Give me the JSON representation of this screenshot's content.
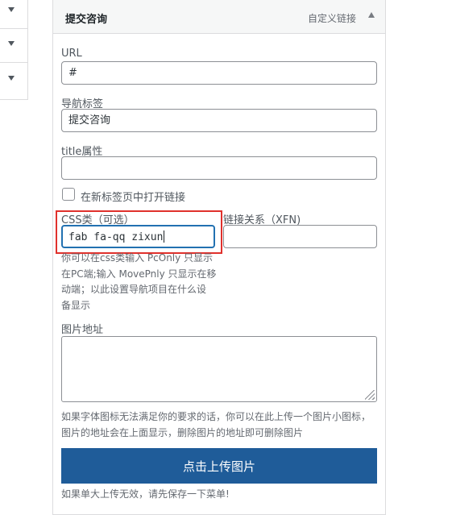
{
  "menu_item": {
    "title": "提交咨询",
    "type": "自定义链接"
  },
  "fields": {
    "url": {
      "label": "URL",
      "value": "#"
    },
    "nav_label": {
      "label": "导航标签",
      "value": "提交咨询"
    },
    "title_attr": {
      "label": "title属性",
      "value": ""
    },
    "new_tab": {
      "label": "在新标签页中打开链接",
      "checked": false
    },
    "css_classes": {
      "label": "CSS类（可选）",
      "value": "fab fa-qq zixun"
    },
    "xfn": {
      "label": "链接关系（XFN)",
      "value": ""
    },
    "image_url": {
      "label": "图片地址",
      "value": ""
    }
  },
  "notes": {
    "css_help_lines": [
      "你可以在css类输入 PcOnly 只显示",
      "在PC端;输入 MovePnly 只显示在移",
      "动端；以此设置导航项目在什么设",
      "备显示"
    ],
    "image_help_lines": [
      "如果字体图标无法满足你的要求的话，你可以在此上传一个图片小图标，",
      "图片的地址会在上面显示，删除图片的地址即可删除图片"
    ],
    "bottom": "如果单大上传无效，请先保存一下菜单!"
  },
  "buttons": {
    "upload": "点击上传图片"
  },
  "colors": {
    "upload_button": "#1f5c99",
    "highlight_box": "#e0312c",
    "focus_border": "#2271b1"
  },
  "icons": {
    "left_toggles": [
      "chevron-down-icon",
      "chevron-down-icon",
      "chevron-down-icon"
    ],
    "item_toggle": "chevron-up-icon"
  }
}
